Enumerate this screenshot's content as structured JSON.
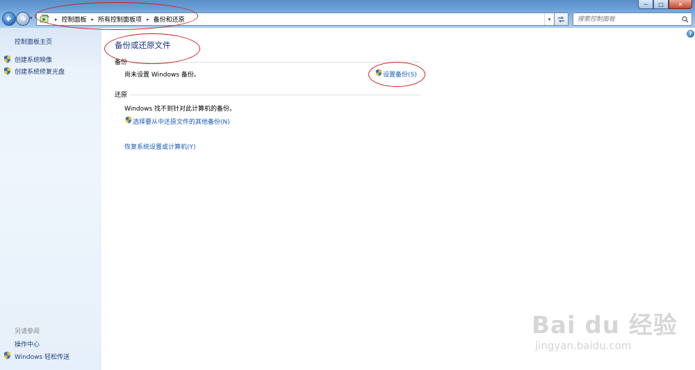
{
  "window": {
    "controls": {
      "minimize": "─",
      "maximize": "□",
      "close": "✕"
    }
  },
  "nav": {
    "back_icon": "back-arrow-icon",
    "forward_icon": "forward-arrow-icon"
  },
  "address": {
    "breadcrumbs": [
      "控制面板",
      "所有控制面板项",
      "备份和还原"
    ],
    "separator": "▸"
  },
  "search": {
    "placeholder": "搜索控制面板"
  },
  "sidebar": {
    "home": "控制面板主页",
    "tasks": [
      {
        "label": "创建系统映像",
        "icon": "uac-shield-icon"
      },
      {
        "label": "创建系统修复光盘",
        "icon": "uac-shield-icon"
      }
    ],
    "see_also_heading": "另请参阅",
    "see_also": [
      {
        "label": "操作中心"
      },
      {
        "label": "Windows 轻松传送",
        "icon": "uac-shield-icon"
      }
    ]
  },
  "main": {
    "title": "备份或还原文件",
    "backup": {
      "heading": "备份",
      "status": "尚未设置 Windows 备份。",
      "setup_link": "设置备份(S)"
    },
    "restore": {
      "heading": "还原",
      "status": "Windows 找不到针对此计算机的备份。",
      "other_backup_link": "选择要从中还原文件的其他备份(N)",
      "recover_link": "恢复系统设置或计算机(Y)"
    },
    "help_glyph": "?"
  },
  "watermark": {
    "logo": "Bai du 经验",
    "url": "jingyan.baidu.com"
  },
  "colors": {
    "link": "#1c5ab8",
    "title": "#1e3287",
    "annotation": "#d21a1a"
  }
}
